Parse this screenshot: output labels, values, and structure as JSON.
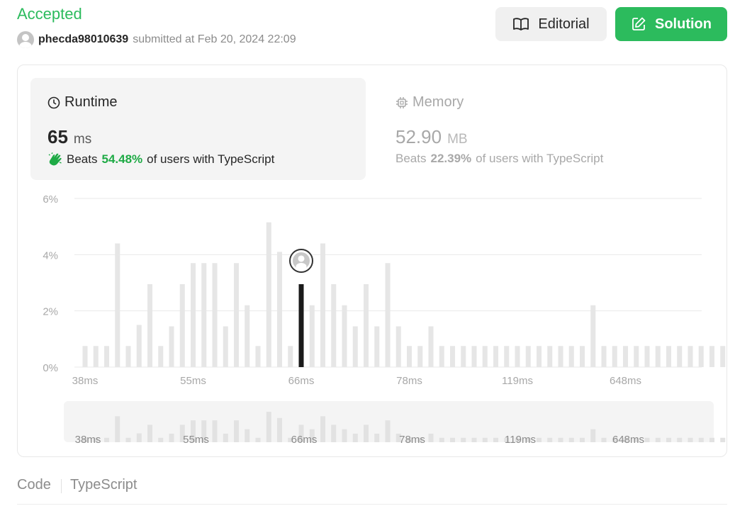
{
  "header": {
    "status": "Accepted",
    "username": "phecda98010639",
    "submitted_text": "submitted at Feb 20, 2024 22:09",
    "editorial_label": "Editorial",
    "solution_label": "Solution"
  },
  "runtime": {
    "title": "Runtime",
    "value": "65",
    "unit": "ms",
    "beats_prefix": "Beats",
    "beats_pct": "54.48%",
    "beats_suffix": "of users with TypeScript"
  },
  "memory": {
    "title": "Memory",
    "value": "52.90",
    "unit": "MB",
    "beats_prefix": "Beats",
    "beats_pct": "22.39%",
    "beats_suffix": "of users with TypeScript"
  },
  "code": {
    "label": "Code",
    "language": "TypeScript"
  },
  "colors": {
    "accent_green": "#2cbb5d",
    "beats_green": "#1eaa45",
    "bar_gray": "#e6e6e6",
    "bar_selected": "#1a1a1a"
  },
  "chart_data": {
    "type": "bar",
    "title": "",
    "xlabel": "",
    "ylabel": "",
    "ylim": [
      0,
      6
    ],
    "y_ticks": [
      "6%",
      "4%",
      "2%",
      "0%"
    ],
    "x_tick_labels": [
      "38ms",
      "55ms",
      "66ms",
      "78ms",
      "119ms",
      "648ms"
    ],
    "selected_index": 20,
    "grid": true,
    "values": [
      0.75,
      0.75,
      0.75,
      4.4,
      0.75,
      1.5,
      2.95,
      0.75,
      1.45,
      2.95,
      3.7,
      3.7,
      3.7,
      1.45,
      3.7,
      2.2,
      0.75,
      5.15,
      4.1,
      0.75,
      2.95,
      2.2,
      4.4,
      2.95,
      2.2,
      1.45,
      2.95,
      1.45,
      3.7,
      1.45,
      0.75,
      0.75,
      1.45,
      0.75,
      0.75,
      0.75,
      0.75,
      0.75,
      0.75,
      0.75,
      0.75,
      0.75,
      0.75,
      0.75,
      0.75,
      0.75,
      0.75,
      2.2,
      0.75,
      0.75,
      0.75,
      0.75,
      0.75,
      0.75,
      0.75,
      0.75,
      0.75,
      0.75,
      0.75,
      0.75
    ]
  }
}
